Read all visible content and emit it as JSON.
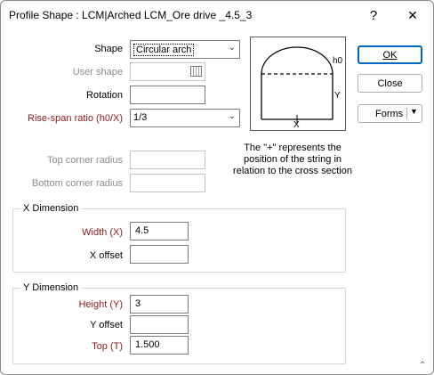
{
  "window": {
    "title": "Profile Shape : LCM|Arched LCM_Ore drive _4.5_3",
    "help_glyph": "?",
    "close_glyph": "✕"
  },
  "form": {
    "shape_label": "Shape",
    "shape_value": "Circular arch",
    "user_shape_label": "User shape",
    "user_shape_value": "",
    "rotation_label": "Rotation",
    "rotation_value": "",
    "rise_span_label": "Rise-span ratio (h0/X)",
    "rise_span_value": "1/3",
    "top_corner_label": "Top corner radius",
    "top_corner_value": "",
    "bottom_corner_label": "Bottom corner radius",
    "bottom_corner_value": ""
  },
  "diagram": {
    "h0_label": "h0",
    "y_label": "Y",
    "x_label": "X",
    "note": "The \"+\" represents the position of the string in relation to the cross section"
  },
  "buttons": {
    "ok": "OK",
    "close": "Close",
    "forms": "Forms"
  },
  "x_dimension": {
    "title": "X Dimension",
    "width_label": "Width (X)",
    "width_value": "4.5",
    "offset_label": "X offset",
    "offset_value": ""
  },
  "y_dimension": {
    "title": "Y Dimension",
    "height_label": "Height (Y)",
    "height_value": "3",
    "offset_label": "Y offset",
    "offset_value": "",
    "top_label": "Top (T)",
    "top_value": "1.500"
  },
  "colors": {
    "required_label": "#8b1a1a",
    "disabled_label": "#8c8c8c",
    "default_button_border": "#0067c0"
  },
  "icons": {
    "chevron": "chevron-down-icon",
    "picker": "shape-picker-icon",
    "grip": "resize-grip-icon"
  }
}
